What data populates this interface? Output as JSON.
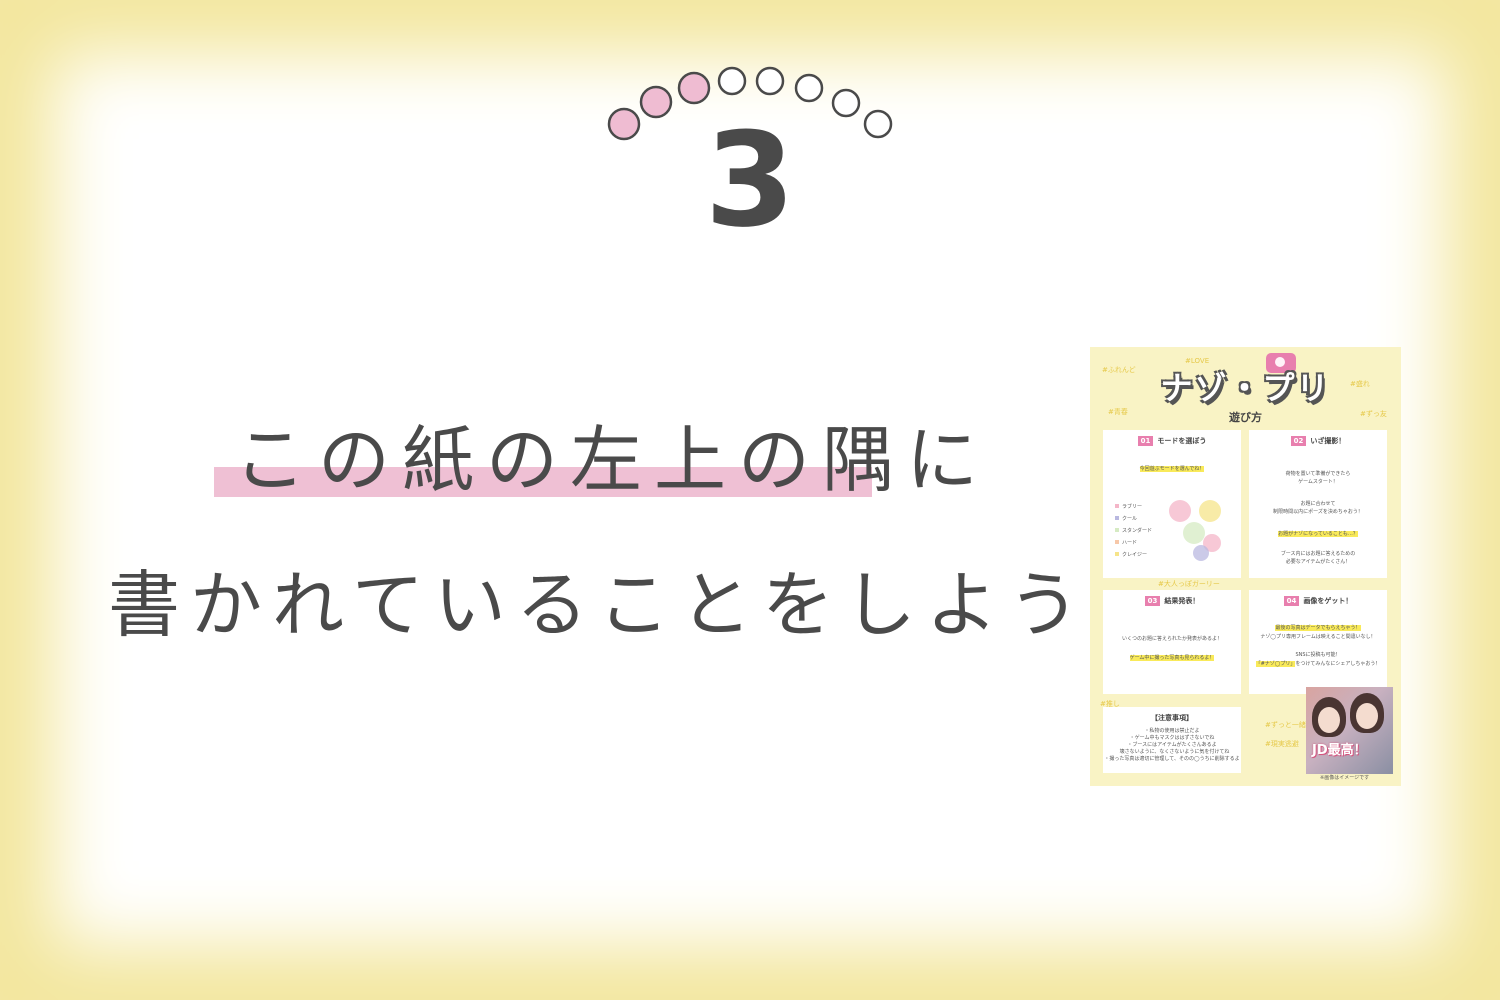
{
  "step": {
    "number": "3",
    "progress_filled": 3,
    "progress_total": 8
  },
  "instruction": {
    "line1": "この紙の左上の隅に",
    "line2": "書かれていることをしよう！"
  },
  "colors": {
    "background_frame": "#f3e79f",
    "highlight": "#efc0d4",
    "dot_filled": "#efbcd2",
    "dot_outline": "#4a4a4a",
    "text": "#4a4a4a"
  },
  "paper": {
    "title": "ナゾ・プリ",
    "subtitle": "遊び方",
    "tags": [
      "#ふれんど",
      "#LOVE",
      "#青春",
      "#ずっ友",
      "#盛れ",
      "#現実逃避",
      "#大人っぽガーリー",
      "#ずっと一緒",
      "#推し"
    ],
    "cards": [
      {
        "num": "01",
        "title": "モードを選ぼう",
        "highlight": "今回遊ぶモードを選んでね！",
        "modes": [
          "ラブリー",
          "クール",
          "スタンダード",
          "ハード",
          "クレイジー"
        ]
      },
      {
        "num": "02",
        "title": "いざ撮影！",
        "lines": [
          "荷物を置いて準備ができたら",
          "ゲームスタート！",
          "",
          "お題に合わせて",
          "制限時間以内にポーズを決めちゃおう！"
        ],
        "highlight": "お題がナゾになっていることも…？",
        "lines2": [
          "ブース内にはお題に答えるための",
          "必要なアイテムがたくさん！"
        ]
      },
      {
        "num": "03",
        "title": "結果発表！",
        "lines": [
          "いくつのお題に答えられたか発表があるよ！"
        ],
        "highlight": "ゲーム中に撮った写真も見られるよ！"
      },
      {
        "num": "04",
        "title": "画像をゲット！",
        "highlight": "最後の写真はデータでもらえちゃう！",
        "lines": [
          "ナゾ◯プリ専用フレームは映えること間違いなし！",
          "",
          "SNSに投稿も可能！"
        ],
        "highlight2": "「#ナゾ◯プリ」",
        "lines2": [
          "をつけてみんなにシェアしちゃおう！"
        ]
      }
    ],
    "notice": {
      "title": "【注意事項】",
      "lines": [
        "・私物の使用は禁止だよ",
        "・ゲーム中もマスクははずさないでね",
        "・ブースにはアイテムがたくさんあるよ",
        "　壊さないように、なくさないように気を付けてね",
        "・撮った写真は適切に管理して、そのの◯うちに削除するよ"
      ]
    },
    "photo_caption": "JD最高！",
    "footnote": "※画像はイメージです"
  }
}
